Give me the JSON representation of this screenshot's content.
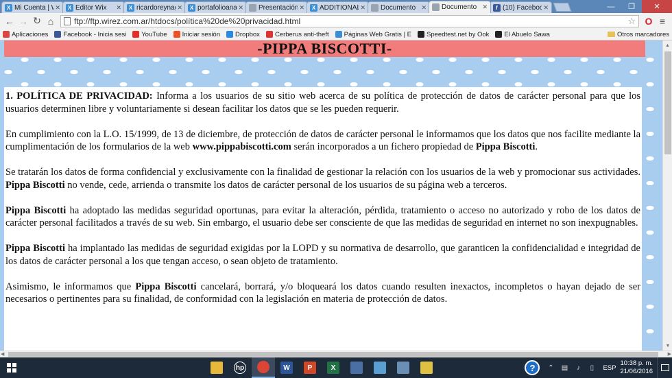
{
  "browser": {
    "tabs": [
      {
        "label": "Mi Cuenta | W",
        "icon": "wix-icon",
        "color": "#3b8fd6",
        "glyph": "X"
      },
      {
        "label": "Editor Wix",
        "icon": "wix-icon",
        "color": "#3b8fd6",
        "glyph": "X"
      },
      {
        "label": "ricardoreynag",
        "icon": "wix-icon",
        "color": "#3b8fd6",
        "glyph": "X"
      },
      {
        "label": "portafolioana",
        "icon": "wix-icon",
        "color": "#3b8fd6",
        "glyph": "X"
      },
      {
        "label": "Presentación",
        "icon": "document-icon",
        "color": "#9aa4b0",
        "glyph": ""
      },
      {
        "label": "ADDITIONAL",
        "icon": "wix-icon",
        "color": "#3b8fd6",
        "glyph": "X"
      },
      {
        "label": "Documento",
        "icon": "document-icon",
        "color": "#9aa4b0",
        "glyph": ""
      },
      {
        "label": "Documento",
        "icon": "document-icon",
        "color": "#9aa4b0",
        "glyph": "",
        "active": true
      },
      {
        "label": "(10) Faceboo",
        "icon": "facebook-icon",
        "color": "#3b5998",
        "glyph": "f"
      }
    ],
    "url": "ftp://ftp.wirez.com.ar/htdocs/política%20de%20privacidad.html",
    "bookmarks": [
      {
        "label": "Aplicaciones",
        "icon": "apps-icon",
        "color": "#d44"
      },
      {
        "label": "Facebook - Inicia sesi",
        "icon": "facebook-icon",
        "color": "#3b5998"
      },
      {
        "label": "YouTube",
        "icon": "youtube-icon",
        "color": "#e52d27"
      },
      {
        "label": "Iniciar sesión",
        "icon": "microsoft-icon",
        "color": "#f25022"
      },
      {
        "label": "Dropbox",
        "icon": "dropbox-icon",
        "color": "#2b8ae0"
      },
      {
        "label": "Cerberus anti-theft",
        "icon": "cerberus-icon",
        "color": "#d33"
      },
      {
        "label": "Páginas Web Gratis | E",
        "icon": "wix-icon",
        "color": "#3b8fd6"
      },
      {
        "label": "Speedtest.net by Ook",
        "icon": "speedtest-icon",
        "color": "#222"
      },
      {
        "label": "El Abuelo Sawa",
        "icon": "bookmark-icon",
        "color": "#222"
      }
    ],
    "other_bookmarks": "Otros marcadores"
  },
  "page": {
    "title": "-PIPPA BISCOTTI-",
    "paragraphs": {
      "p1_heading": "1. POLÍTICA DE PRIVACIDAD:",
      "p1_text": " Informa a los usuarios de su sitio web acerca de su política de protección de datos de carácter personal para que los usuarios determinen libre y voluntariamente si desean facilitar los datos que se les pueden requerir.",
      "p2_text_a": "En cumplimiento con la L.O. 15/1999, de 13 de diciembre, de protección de datos de carácter personal le informamos que los datos que nos facilite mediante la cumplimentación de los formularios de la web ",
      "p2_site": "www.pippabiscotti.com",
      "p2_text_b": " serán incorporados a un fichero propiedad de ",
      "p2_brand": "Pippa Biscotti",
      "p2_text_c": ".",
      "p3_text_a": "Se tratarán los datos de forma confidencial y exclusivamente con la finalidad de gestionar la relación con los usuarios de la web y promocionar sus actividades. ",
      "p3_brand": "Pippa Biscotti",
      "p3_text_b": " no vende, cede, arrienda o transmite los datos de carácter personal de los usuarios de su página web a terceros.",
      "p4_brand": "Pippa Biscotti",
      "p4_text": " ha adoptado las medidas seguridad oportunas, para evitar la alteración, pérdida, tratamiento o acceso no autorizado y robo de los datos de carácter personal facilitados a través de su web. Sin embargo, el usuario debe ser consciente de que las medidas de seguridad en internet no son inexpugnables.",
      "p5_brand": "Pippa Biscotti",
      "p5_text": " ha implantado las medidas de seguridad exigidas por la LOPD y su normativa de desarrollo, que garanticen la confidencialidad e integridad de los datos de carácter personal a los que tengan acceso, o sean objeto de tratamiento.",
      "p6_text_a": "Asimismo, le informamos que ",
      "p6_brand": "Pippa Biscotti",
      "p6_text_b": " cancelará, borrará, y/o bloqueará los datos cuando resulten inexactos, incompletos o hayan dejado de ser necesarios o pertinentes para su finalidad, de conformidad con la legislación en materia de protección de datos."
    }
  },
  "taskbar": {
    "apps": [
      {
        "name": "file-explorer-icon",
        "color": "#e8b83a",
        "glyph": ""
      },
      {
        "name": "hp-icon",
        "color": "#1c2a3a",
        "glyph": "hp"
      },
      {
        "name": "chrome-icon",
        "color": "#db4437",
        "glyph": "",
        "active": true
      },
      {
        "name": "word-icon",
        "color": "#2b579a",
        "glyph": "W"
      },
      {
        "name": "powerpoint-icon",
        "color": "#d24726",
        "glyph": "P"
      },
      {
        "name": "excel-icon",
        "color": "#217346",
        "glyph": "X"
      },
      {
        "name": "app-icon",
        "color": "#4a6fa5",
        "glyph": ""
      },
      {
        "name": "app-icon",
        "color": "#5a9fd4",
        "glyph": ""
      },
      {
        "name": "app-icon",
        "color": "#6a8fb5",
        "glyph": ""
      },
      {
        "name": "app-icon",
        "color": "#e0c040",
        "glyph": ""
      }
    ],
    "language": "ESP",
    "time": "10:38 p. m.",
    "date": "21/06/2016"
  }
}
